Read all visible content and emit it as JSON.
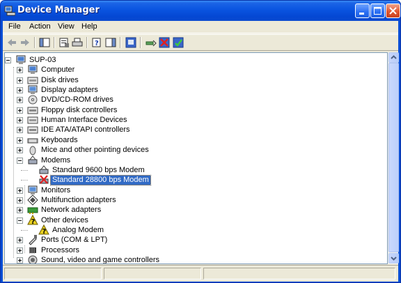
{
  "window": {
    "title": "Device Manager"
  },
  "menu": {
    "items": [
      "File",
      "Action",
      "View",
      "Help"
    ]
  },
  "tree": {
    "root": "SUP-03",
    "nodes": [
      {
        "label": "Computer",
        "icon": "computer-icon"
      },
      {
        "label": "Disk drives",
        "icon": "disk-drive-icon"
      },
      {
        "label": "Display adapters",
        "icon": "display-adapter-icon"
      },
      {
        "label": "DVD/CD-ROM drives",
        "icon": "cdrom-icon"
      },
      {
        "label": "Floppy disk controllers",
        "icon": "floppy-controller-icon"
      },
      {
        "label": "Human Interface Devices",
        "icon": "hid-icon"
      },
      {
        "label": "IDE ATA/ATAPI controllers",
        "icon": "ide-controller-icon"
      },
      {
        "label": "Keyboards",
        "icon": "keyboard-icon"
      },
      {
        "label": "Mice and other pointing devices",
        "icon": "mouse-icon"
      },
      {
        "label": "Modems",
        "icon": "modem-icon",
        "expanded": true
      },
      {
        "label": "Standard  9600 bps Modem",
        "icon": "modem-icon",
        "child": true
      },
      {
        "label": "Standard 28800 bps Modem",
        "icon": "modem-disabled-icon",
        "child": true,
        "selected": true
      },
      {
        "label": "Monitors",
        "icon": "monitor-icon"
      },
      {
        "label": "Multifunction adapters",
        "icon": "multifunction-icon"
      },
      {
        "label": "Network adapters",
        "icon": "network-adapter-icon"
      },
      {
        "label": "Other devices",
        "icon": "unknown-device-icon",
        "expanded": true
      },
      {
        "label": "Analog Modem",
        "icon": "warning-device-icon",
        "child": true
      },
      {
        "label": "Ports (COM & LPT)",
        "icon": "port-icon"
      },
      {
        "label": "Processors",
        "icon": "processor-icon"
      },
      {
        "label": "Sound, video and game controllers",
        "icon": "sound-icon"
      }
    ]
  },
  "colors": {
    "titlebar": "#0a54e0",
    "selection": "#316ac5",
    "chrome": "#ece9d8"
  }
}
